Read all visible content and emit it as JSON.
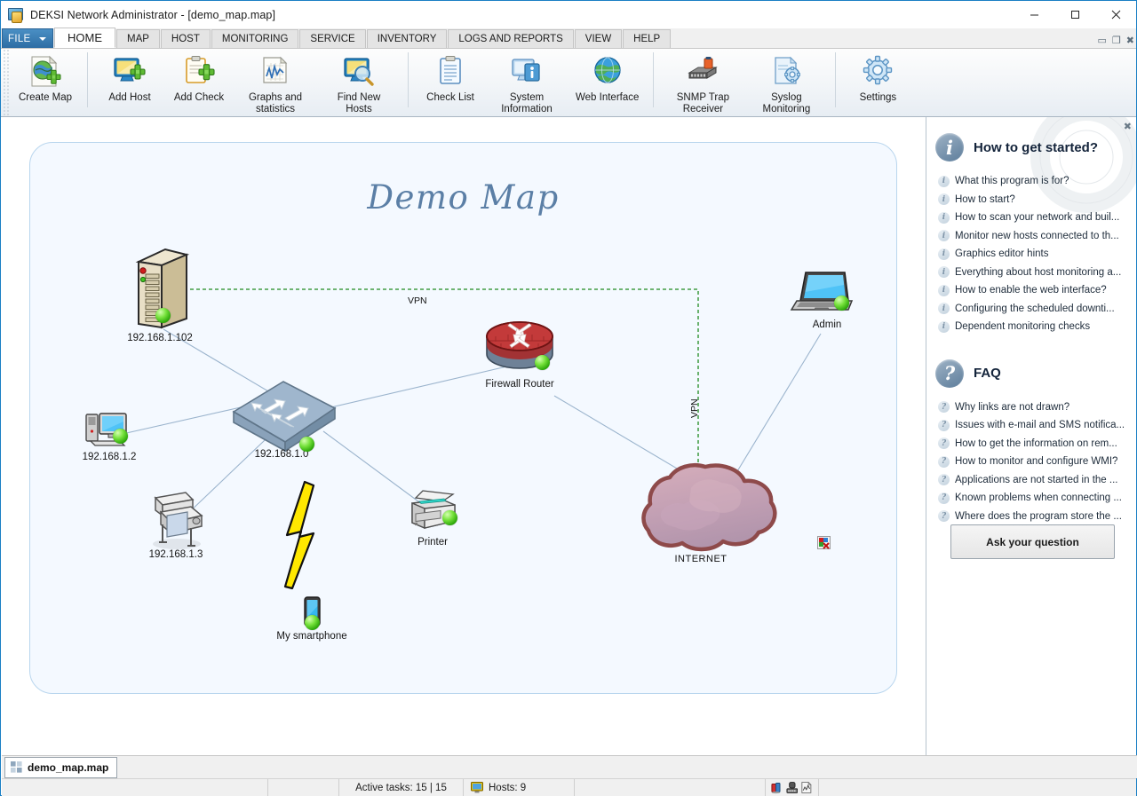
{
  "window": {
    "title": "DEKSI Network Administrator - [demo_map.map]",
    "icon": "app-monitor-key-icon",
    "controls": {
      "minimize": "—",
      "maximize": "▢",
      "close": "✕"
    },
    "mdi_controls": {
      "minimize": "▭",
      "restore": "❐",
      "close": "✖"
    }
  },
  "ribbon": {
    "file_label": "FILE",
    "tabs": [
      {
        "label": "HOME",
        "active": true
      },
      {
        "label": "MAP",
        "active": false
      },
      {
        "label": "HOST",
        "active": false
      },
      {
        "label": "MONITORING",
        "active": false
      },
      {
        "label": "SERVICE",
        "active": false
      },
      {
        "label": "INVENTORY",
        "active": false
      },
      {
        "label": "LOGS AND REPORTS",
        "active": false
      },
      {
        "label": "VIEW",
        "active": false
      },
      {
        "label": "HELP",
        "active": false
      }
    ],
    "groups": [
      {
        "items": [
          {
            "label": "Create Map",
            "icon": "create-map-icon"
          }
        ]
      },
      {
        "items": [
          {
            "label": "Add Host",
            "icon": "add-host-icon"
          },
          {
            "label": "Add Check",
            "icon": "add-check-icon"
          },
          {
            "label": "Graphs and statistics",
            "icon": "graphs-statistics-icon"
          },
          {
            "label": "Find New Hosts",
            "icon": "find-new-hosts-icon"
          }
        ]
      },
      {
        "items": [
          {
            "label": "Check List",
            "icon": "check-list-icon"
          },
          {
            "label": "System Information",
            "icon": "system-information-icon"
          },
          {
            "label": "Web Interface",
            "icon": "web-interface-icon"
          }
        ]
      },
      {
        "items": [
          {
            "label": "SNMP Trap Receiver",
            "icon": "snmp-trap-receiver-icon"
          },
          {
            "label": "Syslog Monitoring",
            "icon": "syslog-monitoring-icon"
          }
        ]
      },
      {
        "items": [
          {
            "label": "Settings",
            "icon": "settings-gear-icon"
          }
        ]
      }
    ]
  },
  "map": {
    "title": "Demo Map",
    "canvas_bg": "#f4f9ff",
    "link_color": "#9bb4cd",
    "vpn_color": "#1f8a1f",
    "nodes": [
      {
        "id": "server",
        "label": "192.168.1.102",
        "icon": "server-tower-icon",
        "status": "up"
      },
      {
        "id": "workstation",
        "label": "192.168.1.2",
        "icon": "desktop-computer-icon",
        "status": "up"
      },
      {
        "id": "plotter",
        "label": "192.168.1.3",
        "icon": "plotter-icon",
        "status": "none"
      },
      {
        "id": "switch",
        "label": "192.168.1.0",
        "icon": "network-switch-icon",
        "status": "up"
      },
      {
        "id": "firewall",
        "label": "Firewall Router",
        "icon": "firewall-router-icon",
        "status": "up"
      },
      {
        "id": "printer",
        "label": "Printer",
        "icon": "printer-icon",
        "status": "up"
      },
      {
        "id": "smartphone",
        "label": "My smartphone",
        "icon": "smartphone-icon",
        "status": "up"
      },
      {
        "id": "internet",
        "label": "INTERNET",
        "icon": "internet-cloud-icon",
        "status": "none"
      },
      {
        "id": "admin",
        "label": "Admin",
        "icon": "laptop-icon",
        "status": "up"
      }
    ],
    "vpn_label_h": "VPN",
    "vpn_label_v": "VPN",
    "wireless_icon": "wireless-lightning-icon",
    "broken_link_icon": "broken-image-icon"
  },
  "help_pane": {
    "close_label": "✖",
    "started": {
      "title": "How to get started?",
      "badge": "i",
      "items": [
        "What this program is for?",
        "How to start?",
        "How to scan your network and buil...",
        "Monitor new hosts connected to th...",
        "Graphics editor hints",
        "Everything about host monitoring a...",
        "How to enable the web interface?",
        "Configuring the scheduled downti...",
        "Dependent monitoring checks"
      ]
    },
    "faq": {
      "title": "FAQ",
      "badge": "?",
      "items": [
        "Why links are not drawn?",
        "Issues with e-mail and SMS notifica...",
        "How to get the information on rem...",
        "How to monitor and configure WMI?",
        "Applications are not started in the ...",
        "Known problems when connecting ...",
        "Where does the program store the ..."
      ]
    },
    "ask_button": "Ask your question"
  },
  "doc_tabs": [
    {
      "label": "demo_map.map",
      "icon": "map-document-icon",
      "active": true
    }
  ],
  "status_bar": {
    "active_tasks": "Active tasks: 15 | 15",
    "hosts": "Hosts: 9",
    "hosts_icon": "monitor-icon",
    "tray_icons": [
      "network-scanner-icon",
      "snmp-device-icon",
      "report-page-icon"
    ]
  }
}
